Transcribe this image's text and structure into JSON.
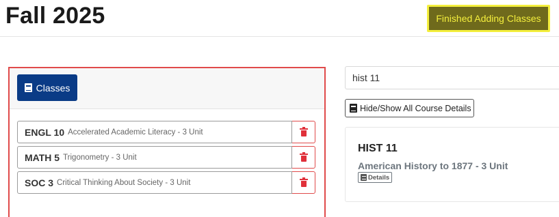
{
  "header": {
    "title": "Fall 2025",
    "finish_label": "Finished Adding Classes"
  },
  "classes": {
    "button_label": "Classes",
    "items": [
      {
        "code": "ENGL 10",
        "desc": "Accelerated Academic Literacy - 3 Unit"
      },
      {
        "code": "MATH 5",
        "desc": "Trigonometry - 3 Unit"
      },
      {
        "code": "SOC 3",
        "desc": "Critical Thinking About Society - 3 Unit"
      }
    ]
  },
  "search": {
    "value": "hist 11"
  },
  "toggle_details_label": "Hide/Show All Course Details",
  "result": {
    "code": "HIST 11",
    "title": "American History to 1877 - 3 Unit",
    "details_label": "Details"
  },
  "icons": {
    "classes_button": "book-icon",
    "toggle_button": "book-icon",
    "details_button": "book-icon",
    "remove": "trash-icon"
  },
  "colors": {
    "primary": "#0a3b86",
    "finish_bg": "#6f6a1c",
    "finish_text": "#f4ef3d",
    "highlight": "#f4ef3d",
    "danger": "#e04a4a"
  }
}
